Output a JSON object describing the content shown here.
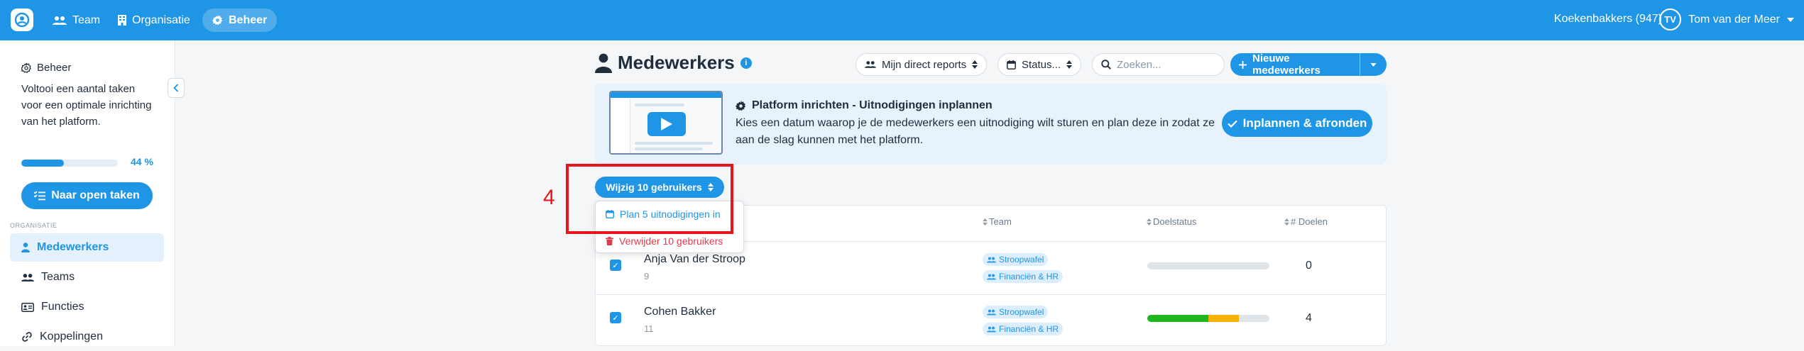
{
  "topbar": {
    "nav": [
      {
        "label": "Team",
        "icon": "users-icon"
      },
      {
        "label": "Organisatie",
        "icon": "building-icon"
      },
      {
        "label": "Beheer",
        "icon": "gear-icon",
        "active": true
      }
    ],
    "organization": "Koekenbakkers (947)",
    "user": {
      "initials": "TV",
      "name": "Tom van der Meer"
    }
  },
  "sidebar": {
    "heading": "Beheer",
    "description": "Voltooi een aantal taken voor een optimale inrichting van het platform.",
    "progress_percent": 44,
    "progress_label": "44 %",
    "open_tasks_button": "Naar open taken",
    "section_label": "ORGANISATIE",
    "items": [
      {
        "label": "Medewerkers",
        "icon": "person-icon",
        "active": true
      },
      {
        "label": "Teams",
        "icon": "users-icon"
      },
      {
        "label": "Functies",
        "icon": "id-card-icon"
      },
      {
        "label": "Koppelingen",
        "icon": "link-icon"
      }
    ]
  },
  "main": {
    "title": "Medewerkers",
    "filter_reports": "Mijn direct reports",
    "filter_status": "Status...",
    "search_placeholder": "Zoeken...",
    "new_button": "Nieuwe medewerkers",
    "banner": {
      "title": "Platform inrichten - Uitnodigingen inplannen",
      "description": "Kies een datum waarop je de medewerkers een uitnodiging wilt sturen en plan deze in zodat ze aan de slag kunnen met het platform.",
      "button": "Inplannen & afronden"
    },
    "bulk_button": "Wijzig 10 gebruikers",
    "bulk_menu": {
      "plan": "Plan 5 uitnodigingen in",
      "delete": "Verwijder 10 gebruikers"
    },
    "table": {
      "columns": [
        "Team",
        "Doelstatus",
        "# Doelen"
      ],
      "rows": [
        {
          "name": "Anja Van der Stroop",
          "sub": "9",
          "teams": [
            "Stroopwafel",
            "Financiën & HR"
          ],
          "goal_status": {
            "green": 0,
            "orange": 0
          },
          "goals": "0"
        },
        {
          "name": "Cohen Bakker",
          "sub": "11",
          "teams": [
            "Stroopwafel",
            "Financiën & HR"
          ],
          "goal_status": {
            "green": 0.5,
            "orange": 0.25
          },
          "goals": "4"
        }
      ]
    }
  },
  "annotation": {
    "step_number": "4"
  },
  "colors": {
    "primary": "#1f95e6",
    "danger": "#e03b4d",
    "green": "#1fb71f",
    "orange": "#f6b10a",
    "highlight": "#e8151b"
  }
}
